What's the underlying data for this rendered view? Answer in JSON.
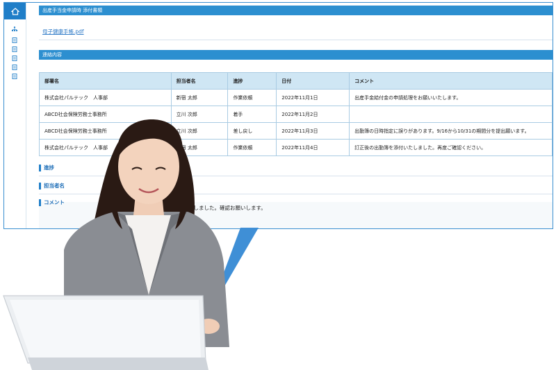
{
  "attach_section": {
    "title": "出産手当金申請時 添付書類",
    "file_link": "母子健康手帳.pdf"
  },
  "contact_section": {
    "title": "連絡内容"
  },
  "table": {
    "headers": [
      "部署名",
      "担当者名",
      "進捗",
      "日付",
      "コメント"
    ],
    "rows": [
      [
        "株式会社パルテック　人事部",
        "新宿 太郎",
        "作業依頼",
        "2022年11月1日",
        "出産手金給付金の申請処理をお願いいたします。"
      ],
      [
        "ABCD社会保険労務士事務所",
        "立川 次郎",
        "着手",
        "2022年11月2日",
        ""
      ],
      [
        "ABCD社会保険労務士事務所",
        "立川 次郎",
        "差し戻し",
        "2022年11月3日",
        "出勤簿の日時指定に誤りがあります。9/16から10/31の期間分を提出願います。"
      ],
      [
        "株式会社パルテック　人事部",
        "新宿 太郎",
        "作業依頼",
        "2022年11月4日",
        "訂正後の出勤簿を添付いたしました。再度ご確認ください。"
      ]
    ]
  },
  "form": {
    "progress_label": "進捗",
    "person_label": "担当者名",
    "comment_label": "コメント",
    "comment_value": "ロードしました。確認お願いします。"
  },
  "icons": [
    "home-icon",
    "org-chart-icon",
    "document-icon"
  ],
  "colors": {
    "accent": "#1f7ec8",
    "header_bar": "#2c8fd0",
    "table_header": "#cfe6f4"
  }
}
